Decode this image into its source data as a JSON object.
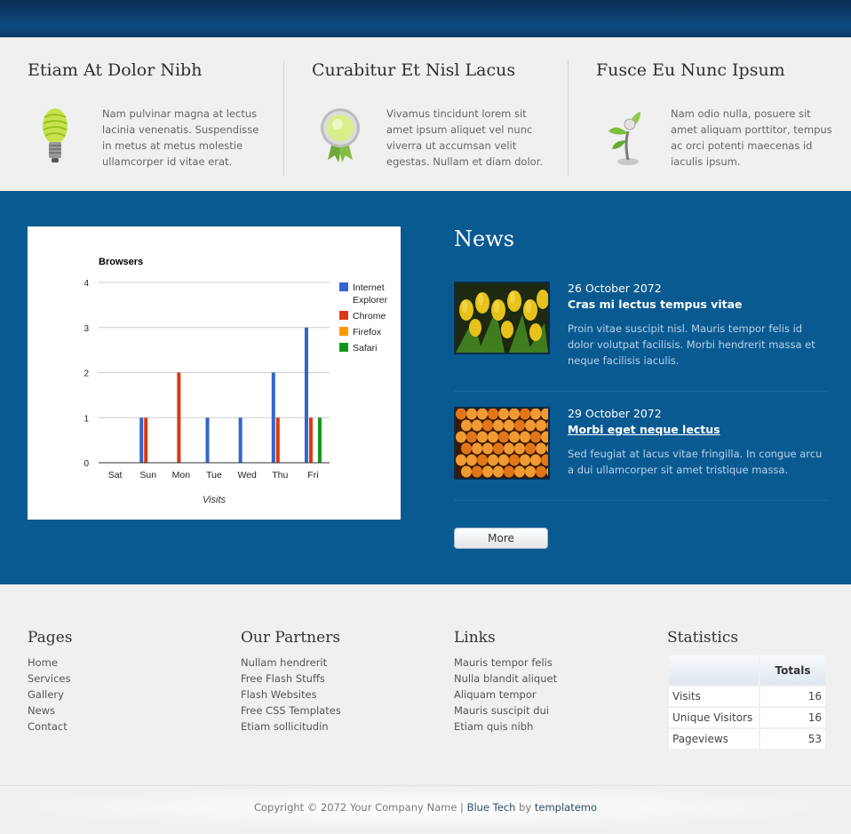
{
  "features": [
    {
      "title": "Etiam At Dolor Nibh",
      "text": "Nam pulvinar magna at lectus lacinia venenatis. Suspendisse in metus at metus molestie ullamcorper id vitae erat.",
      "icon": "lightbulb-icon"
    },
    {
      "title": "Curabitur Et Nisl Lacus",
      "text": "Vivamus tincidunt lorem sit amet ipsum aliquet vel nunc viverra ut accumsan velit egestas. Nullam et diam dolor.",
      "icon": "award-ribbon-icon"
    },
    {
      "title": "Fusce Eu Nunc Ipsum",
      "text": "Nam odio nulla, posuere sit amet aliquam porttitor, tempus ac orci potenti maecenas id iaculis ipsum.",
      "icon": "plant-fan-icon"
    }
  ],
  "chart_data": {
    "type": "bar",
    "title": "Browsers",
    "xlabel": "Visits",
    "ylabel": "",
    "categories": [
      "Sat",
      "Sun",
      "Mon",
      "Tue",
      "Wed",
      "Thu",
      "Fri"
    ],
    "ylim": [
      0,
      4
    ],
    "yticks": [
      "0",
      "1",
      "2",
      "3",
      "4"
    ],
    "grid": true,
    "legend": "right",
    "series": [
      {
        "name": "Internet Explorer",
        "color": "#3366cc",
        "values": [
          0,
          1,
          0,
          1,
          1,
          2,
          3
        ]
      },
      {
        "name": "Chrome",
        "color": "#dc3912",
        "values": [
          0,
          1,
          2,
          0,
          0,
          1,
          1
        ]
      },
      {
        "name": "Firefox",
        "color": "#ff9900",
        "values": [
          0,
          0,
          0,
          0,
          0,
          0,
          0
        ]
      },
      {
        "name": "Safari",
        "color": "#109618",
        "values": [
          0,
          0,
          0,
          0,
          0,
          0,
          1
        ]
      }
    ]
  },
  "news": {
    "title": "News",
    "items": [
      {
        "date": "26 October 2072",
        "headline": "Cras mi lectus tempus vitae",
        "text": "Proin vitae suscipit nisl. Mauris tempor felis id dolor volutpat facilisis. Morbi hendrerit massa et neque facilisis iaculis.",
        "image": "yellow-tulips-photo"
      },
      {
        "date": "29 October 2072",
        "headline": "Morbi eget neque lectus",
        "text": "Sed feugiat at lacus vitae fringilla. In congue arcu a dui ullamcorper sit amet tristique massa.",
        "image": "orange-tulips-photo"
      }
    ],
    "more_label": "More"
  },
  "footer": {
    "pages": {
      "title": "Pages",
      "links": [
        "Home",
        "Services",
        "Gallery",
        "News",
        "Contact"
      ]
    },
    "partners": {
      "title": "Our Partners",
      "links": [
        "Nullam hendrerit",
        "Free Flash Stuffs",
        "Flash Websites",
        "Free CSS Templates",
        "Etiam sollicitudin"
      ]
    },
    "links": {
      "title": "Links",
      "links": [
        "Mauris tempor felis",
        "Nulla blandit aliquet",
        "Aliquam tempor",
        "Mauris suscipit dui",
        "Etiam quis nibh"
      ]
    },
    "statistics": {
      "title": "Statistics",
      "header": "Totals",
      "rows": [
        {
          "label": "Visits",
          "value": "16"
        },
        {
          "label": "Unique Visitors",
          "value": "16"
        },
        {
          "label": "Pageviews",
          "value": "53"
        }
      ]
    }
  },
  "copyright": {
    "prefix": "Copyright © 2072 Your Company Name | ",
    "site": "Blue Tech",
    "by": " by ",
    "author": "templatemo"
  }
}
